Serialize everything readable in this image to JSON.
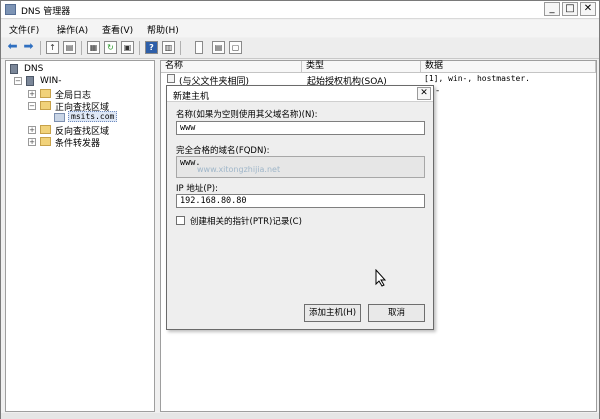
{
  "window": {
    "title": "DNS 管理器",
    "controls": {
      "minimize": "_",
      "maximize": "□",
      "close": "✕"
    }
  },
  "menu": [
    {
      "label": "文件(F)"
    },
    {
      "label": "操作(A)"
    },
    {
      "label": "查看(V)"
    },
    {
      "label": "帮助(H)"
    }
  ],
  "toolbar": {
    "icons": [
      "back-arrow-icon",
      "forward-arrow-icon",
      "up-folder-icon",
      "show-hide-tree-icon",
      "properties-icon",
      "refresh-icon",
      "export-list-icon",
      "help-icon",
      "panel-icon",
      "list-view-icon",
      "details-view-icon",
      "new-record-icon"
    ]
  },
  "tree": {
    "root": "DNS",
    "server": "WIN-",
    "items": [
      {
        "label": "全局日志"
      },
      {
        "label": "正向查找区域"
      },
      {
        "label": "msits.com"
      },
      {
        "label": "反向查找区域"
      },
      {
        "label": "条件转发器"
      }
    ]
  },
  "list": {
    "columns": [
      "名称",
      "类型",
      "数据"
    ],
    "rows": [
      [
        "(与父文件夹相同)",
        "起始授权机构(SOA)",
        "[1], win-, hostmaster."
      ],
      [
        "",
        "",
        "-"
      ]
    ]
  },
  "dialog": {
    "title": "新建主机",
    "close": "✕",
    "name_label": "名称(如果为空则使用其父域名称)(N):",
    "name_value": "www",
    "fqdn_label": "完全合格的域名(FQDN):",
    "fqdn_value": "www.",
    "watermark": "www.xitongzhijia.net",
    "ip_label": "IP 地址(P):",
    "ip_value": "192.168.80.80",
    "ptr_label": "创建相关的指针(PTR)记录(C)",
    "ptr_checked": false,
    "add_button": "添加主机(H)",
    "cancel_button": "取消"
  }
}
